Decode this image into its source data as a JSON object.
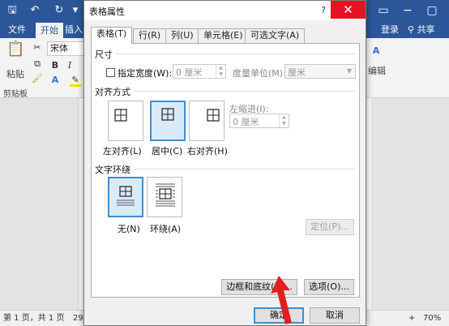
{
  "word": {
    "menu": {
      "file": "文件",
      "home": "开始",
      "insert": "插入",
      "login": "登录",
      "share": "共享"
    },
    "ribbon": {
      "font_name": "宋体",
      "paste": "粘贴",
      "clipboard": "剪贴板",
      "bold": "B",
      "italic": "I",
      "text_effect": "A",
      "edit": "编辑",
      "right_a": "A"
    },
    "status": {
      "page": "第 1 页，共 1 页",
      "words": "29",
      "zoom": "70%"
    }
  },
  "dialog": {
    "title": "表格属性",
    "help": "?",
    "close": "✕",
    "tabs": [
      {
        "label": "表格(T)",
        "active": true
      },
      {
        "label": "行(R)"
      },
      {
        "label": "列(U)"
      },
      {
        "label": "单元格(E)"
      },
      {
        "label": "可选文字(A)"
      }
    ],
    "size": {
      "label": "尺寸",
      "pref_width_label": "指定宽度(W):",
      "pref_width_value": "0 厘米",
      "measure_label": "度量单位(M):",
      "measure_value": "厘米"
    },
    "alignment": {
      "label": "对齐方式",
      "options": [
        "左对齐(L)",
        "居中(C)",
        "右对齐(H)"
      ],
      "selected": 1,
      "indent_label": "左缩进(I):",
      "indent_value": "0 厘米"
    },
    "wrapping": {
      "label": "文字环绕",
      "options": [
        "无(N)",
        "环绕(A)"
      ],
      "selected": 0,
      "position_button": "定位(P)..."
    },
    "buttons": {
      "borders": "边框和底纹(B)...",
      "options": "选项(O)...",
      "ok": "确定",
      "cancel": "取消"
    }
  },
  "colors": {
    "word_blue": "#2b579a",
    "selection_blue": "#3a8fd6",
    "close_red": "#e81123",
    "arrow_red": "#e02020"
  }
}
